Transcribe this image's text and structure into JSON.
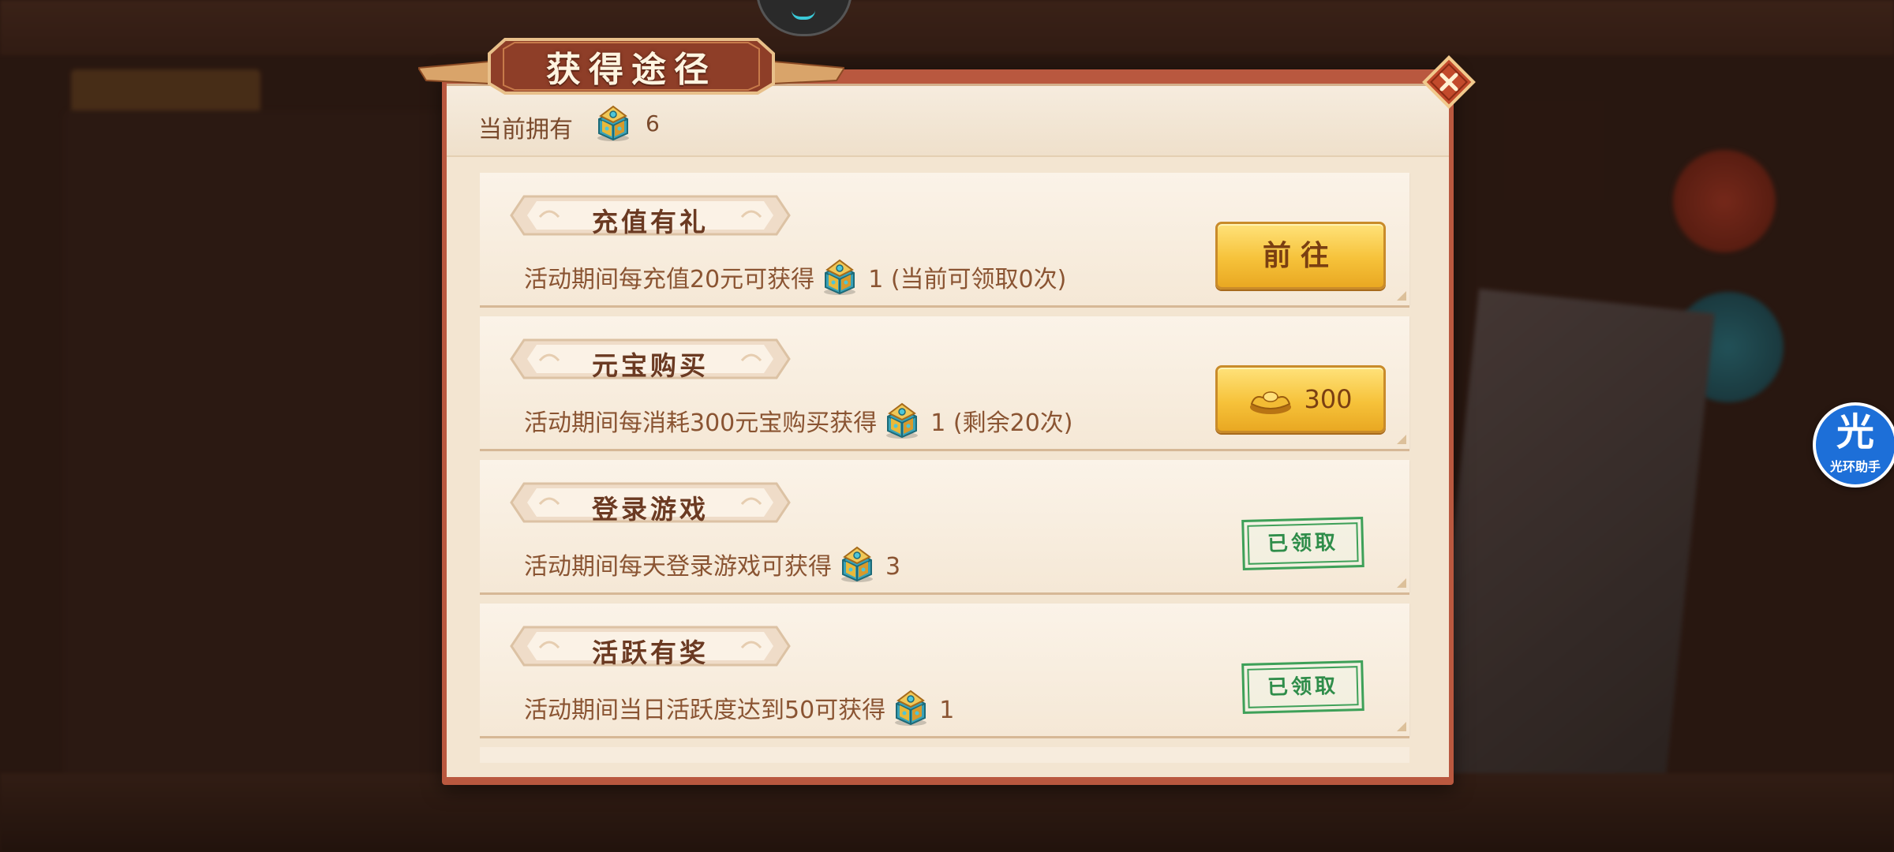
{
  "dialog": {
    "title": "获得途径",
    "owned_label": "当前拥有",
    "owned_count": "6"
  },
  "cards": [
    {
      "title": "充值有礼",
      "desc": "活动期间每充值20元可获得",
      "qty": "1",
      "suffix": "(当前可领取0次)",
      "action": "前往"
    },
    {
      "title": "元宝购买",
      "desc": "活动期间每消耗300元宝购买获得",
      "qty": "1",
      "suffix": "(剩余20次)",
      "price": "300"
    },
    {
      "title": "登录游戏",
      "desc": "活动期间每天登录游戏可获得",
      "qty": "3",
      "status": "已领取"
    },
    {
      "title": "活跃有奖",
      "desc": "活动期间当日活跃度达到50可获得",
      "qty": "1",
      "status": "已领取"
    }
  ],
  "assistant": {
    "char": "光",
    "label": "光环助手"
  },
  "icons": {
    "item": "treasure-chest-icon",
    "currency": "gold-ingot-icon",
    "close": "close-icon"
  },
  "colors": {
    "frame": "#b9583f",
    "panel": "#f3e5d1",
    "text_brown": "#8a5432",
    "button_gold": "#f6c23a",
    "stamp_green": "#3ea058",
    "assistant_blue": "#1d6fd8"
  }
}
